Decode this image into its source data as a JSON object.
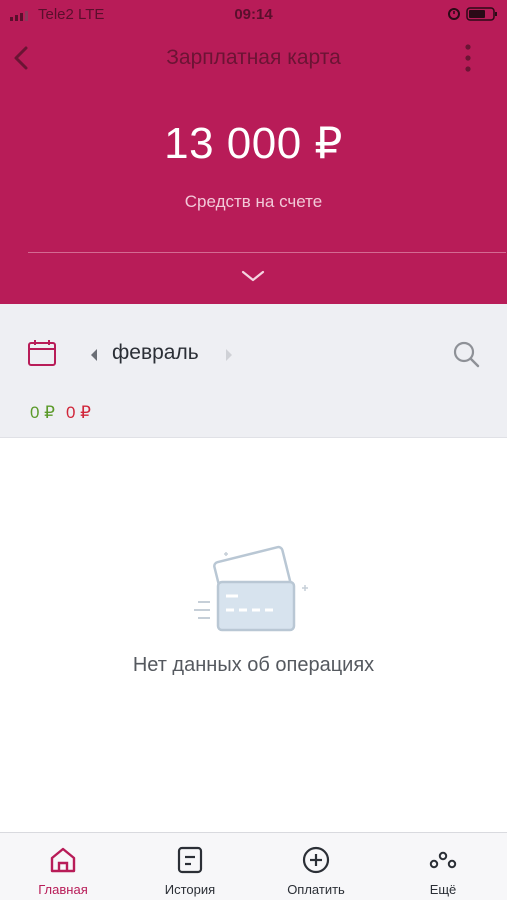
{
  "status_bar": {
    "carrier": "Tele2  LTE",
    "time": "09:14",
    "signal_icon": "signal-bars-icon",
    "alarm_icon": "alarm-icon",
    "battery_icon": "battery-icon"
  },
  "nav": {
    "title": "Зарплатная карта",
    "back_icon": "chevron-left-icon",
    "more_icon": "more-vertical-icon"
  },
  "balance": {
    "amount": "13 000 ₽",
    "caption": "Средств на счете",
    "expand_icon": "chevron-down-icon"
  },
  "filter": {
    "month": "февраль",
    "income": "0 ₽",
    "expense": "0 ₽",
    "calendar_icon": "calendar-icon",
    "search_icon": "search-icon"
  },
  "empty_state": {
    "message": "Нет данных об операциях",
    "illustration_icon": "cards-icon"
  },
  "tabbar": {
    "items": [
      {
        "label": "Главная",
        "icon": "home-icon",
        "active": true
      },
      {
        "label": "История",
        "icon": "history-icon",
        "active": false
      },
      {
        "label": "Оплатить",
        "icon": "plus-circle-icon",
        "active": false
      },
      {
        "label": "Ещё",
        "icon": "more-dots-icon",
        "active": false
      }
    ]
  },
  "colors": {
    "brand": "#b81c58",
    "income": "#5b9a2a",
    "expense": "#d0263a",
    "filter_bg": "#eeeff3"
  }
}
